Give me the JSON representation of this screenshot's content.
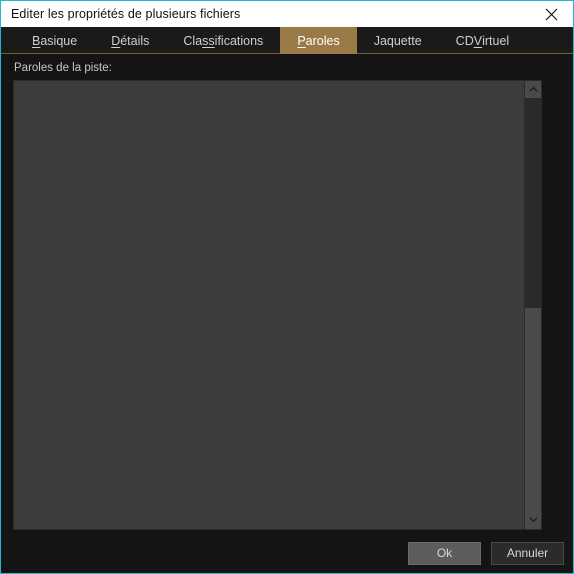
{
  "window": {
    "title": "Editer les propriétés de plusieurs fichiers",
    "close_icon": "close-icon",
    "accent_color": "#29b2d4",
    "titlebar_bg": "#ffffff",
    "body_bg": "#141414"
  },
  "tabs": {
    "items": [
      {
        "label": "Basique",
        "pre": "",
        "acc": "B",
        "post": "asique",
        "active": false
      },
      {
        "label": "Détails",
        "pre": "",
        "acc": "D",
        "post": "étails",
        "active": false
      },
      {
        "label": "Classifications",
        "pre": "Cla",
        "acc": "ss",
        "post": "ifications",
        "active": false
      },
      {
        "label": "Paroles",
        "pre": "",
        "acc": "P",
        "post": "aroles",
        "active": true
      },
      {
        "label": "Jaquette",
        "pre": "Jaquette",
        "acc": "",
        "post": "",
        "active": false
      },
      {
        "label": "CD Virtuel",
        "pre": "CD ",
        "acc": "V",
        "post": "irtuel",
        "active": false
      }
    ],
    "active_tab": "Paroles",
    "active_bg": "#9a7b47",
    "underline_color": "#7a5c2e"
  },
  "main": {
    "field_label": "Paroles de la piste:",
    "lyrics_value": "",
    "lyrics_placeholder": "",
    "textarea_bg": "#3c3c3c"
  },
  "scrollbar": {
    "up_icon": "chevron-up-icon",
    "down_icon": "chevron-down-icon",
    "track_color": "#4a4a4a",
    "thumb_color": "#2a2a2a"
  },
  "footer": {
    "ok_label": "Ok",
    "cancel_label": "Annuler"
  }
}
